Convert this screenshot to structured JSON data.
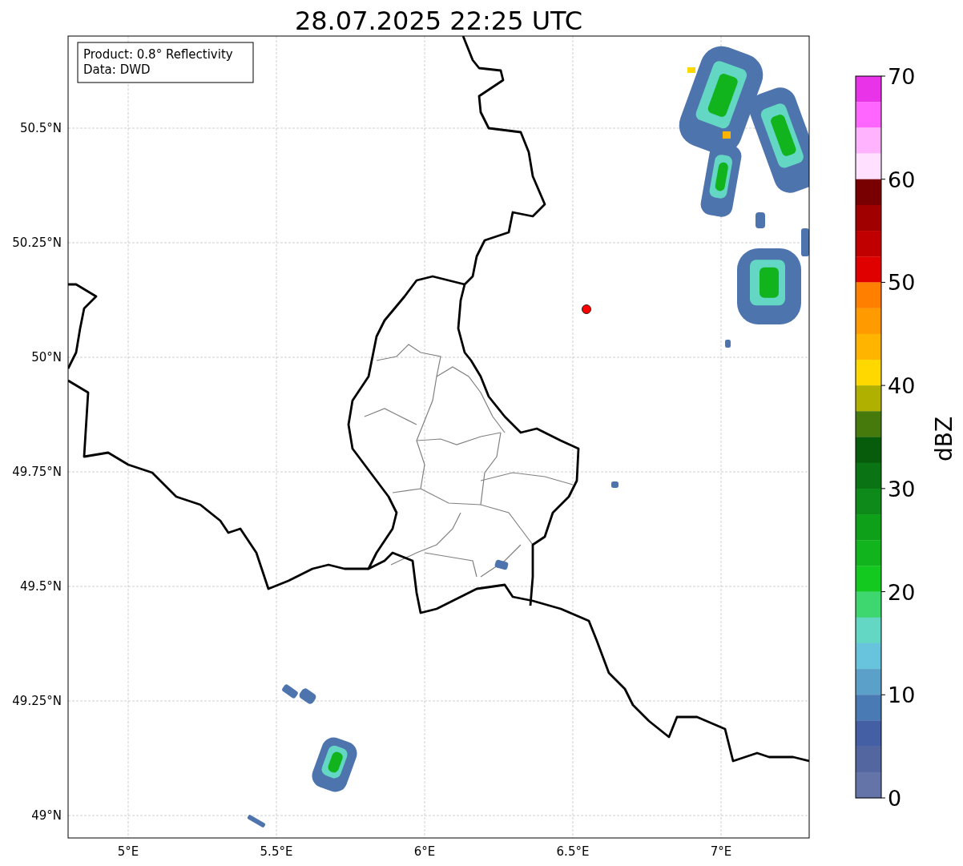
{
  "title": "28.07.2025 22:25 UTC",
  "info_box": {
    "lines": [
      "Product: 0.8° Reflectivity",
      "Data: DWD"
    ]
  },
  "map": {
    "lat_labels": [
      "50.5°N",
      "50.25°N",
      "50°N",
      "49.75°N",
      "49.5°N",
      "49.25°N",
      "49°N"
    ],
    "lon_labels": [
      "5°E",
      "5.5°E",
      "6°E",
      "6.5°E",
      "7°E"
    ]
  },
  "colorbar": {
    "label": "dBZ",
    "ticks": [
      "70",
      "60",
      "50",
      "40",
      "30",
      "20",
      "10",
      "0"
    ],
    "bins": [
      {
        "color": "#e833e8"
      },
      {
        "color": "#ff66ff"
      },
      {
        "color": "#ffb3ff"
      },
      {
        "color": "#ffe0ff"
      },
      {
        "color": "#780000"
      },
      {
        "color": "#a00000"
      },
      {
        "color": "#c00000"
      },
      {
        "color": "#e00000"
      },
      {
        "color": "#ff7f00"
      },
      {
        "color": "#ff9a00"
      },
      {
        "color": "#ffb400"
      },
      {
        "color": "#ffd800"
      },
      {
        "color": "#b0b000"
      },
      {
        "color": "#467a0c"
      },
      {
        "color": "#075c0c"
      },
      {
        "color": "#0a7414"
      },
      {
        "color": "#0e8a1a"
      },
      {
        "color": "#0fa01a"
      },
      {
        "color": "#11b41d"
      },
      {
        "color": "#13c81e"
      },
      {
        "color": "#3ed66e"
      },
      {
        "color": "#63d6c4"
      },
      {
        "color": "#68c4dc"
      },
      {
        "color": "#5aa0c8"
      },
      {
        "color": "#4a7ab4"
      },
      {
        "color": "#445fa4"
      },
      {
        "color": "#5466a0"
      },
      {
        "color": "#6474a8"
      }
    ]
  }
}
